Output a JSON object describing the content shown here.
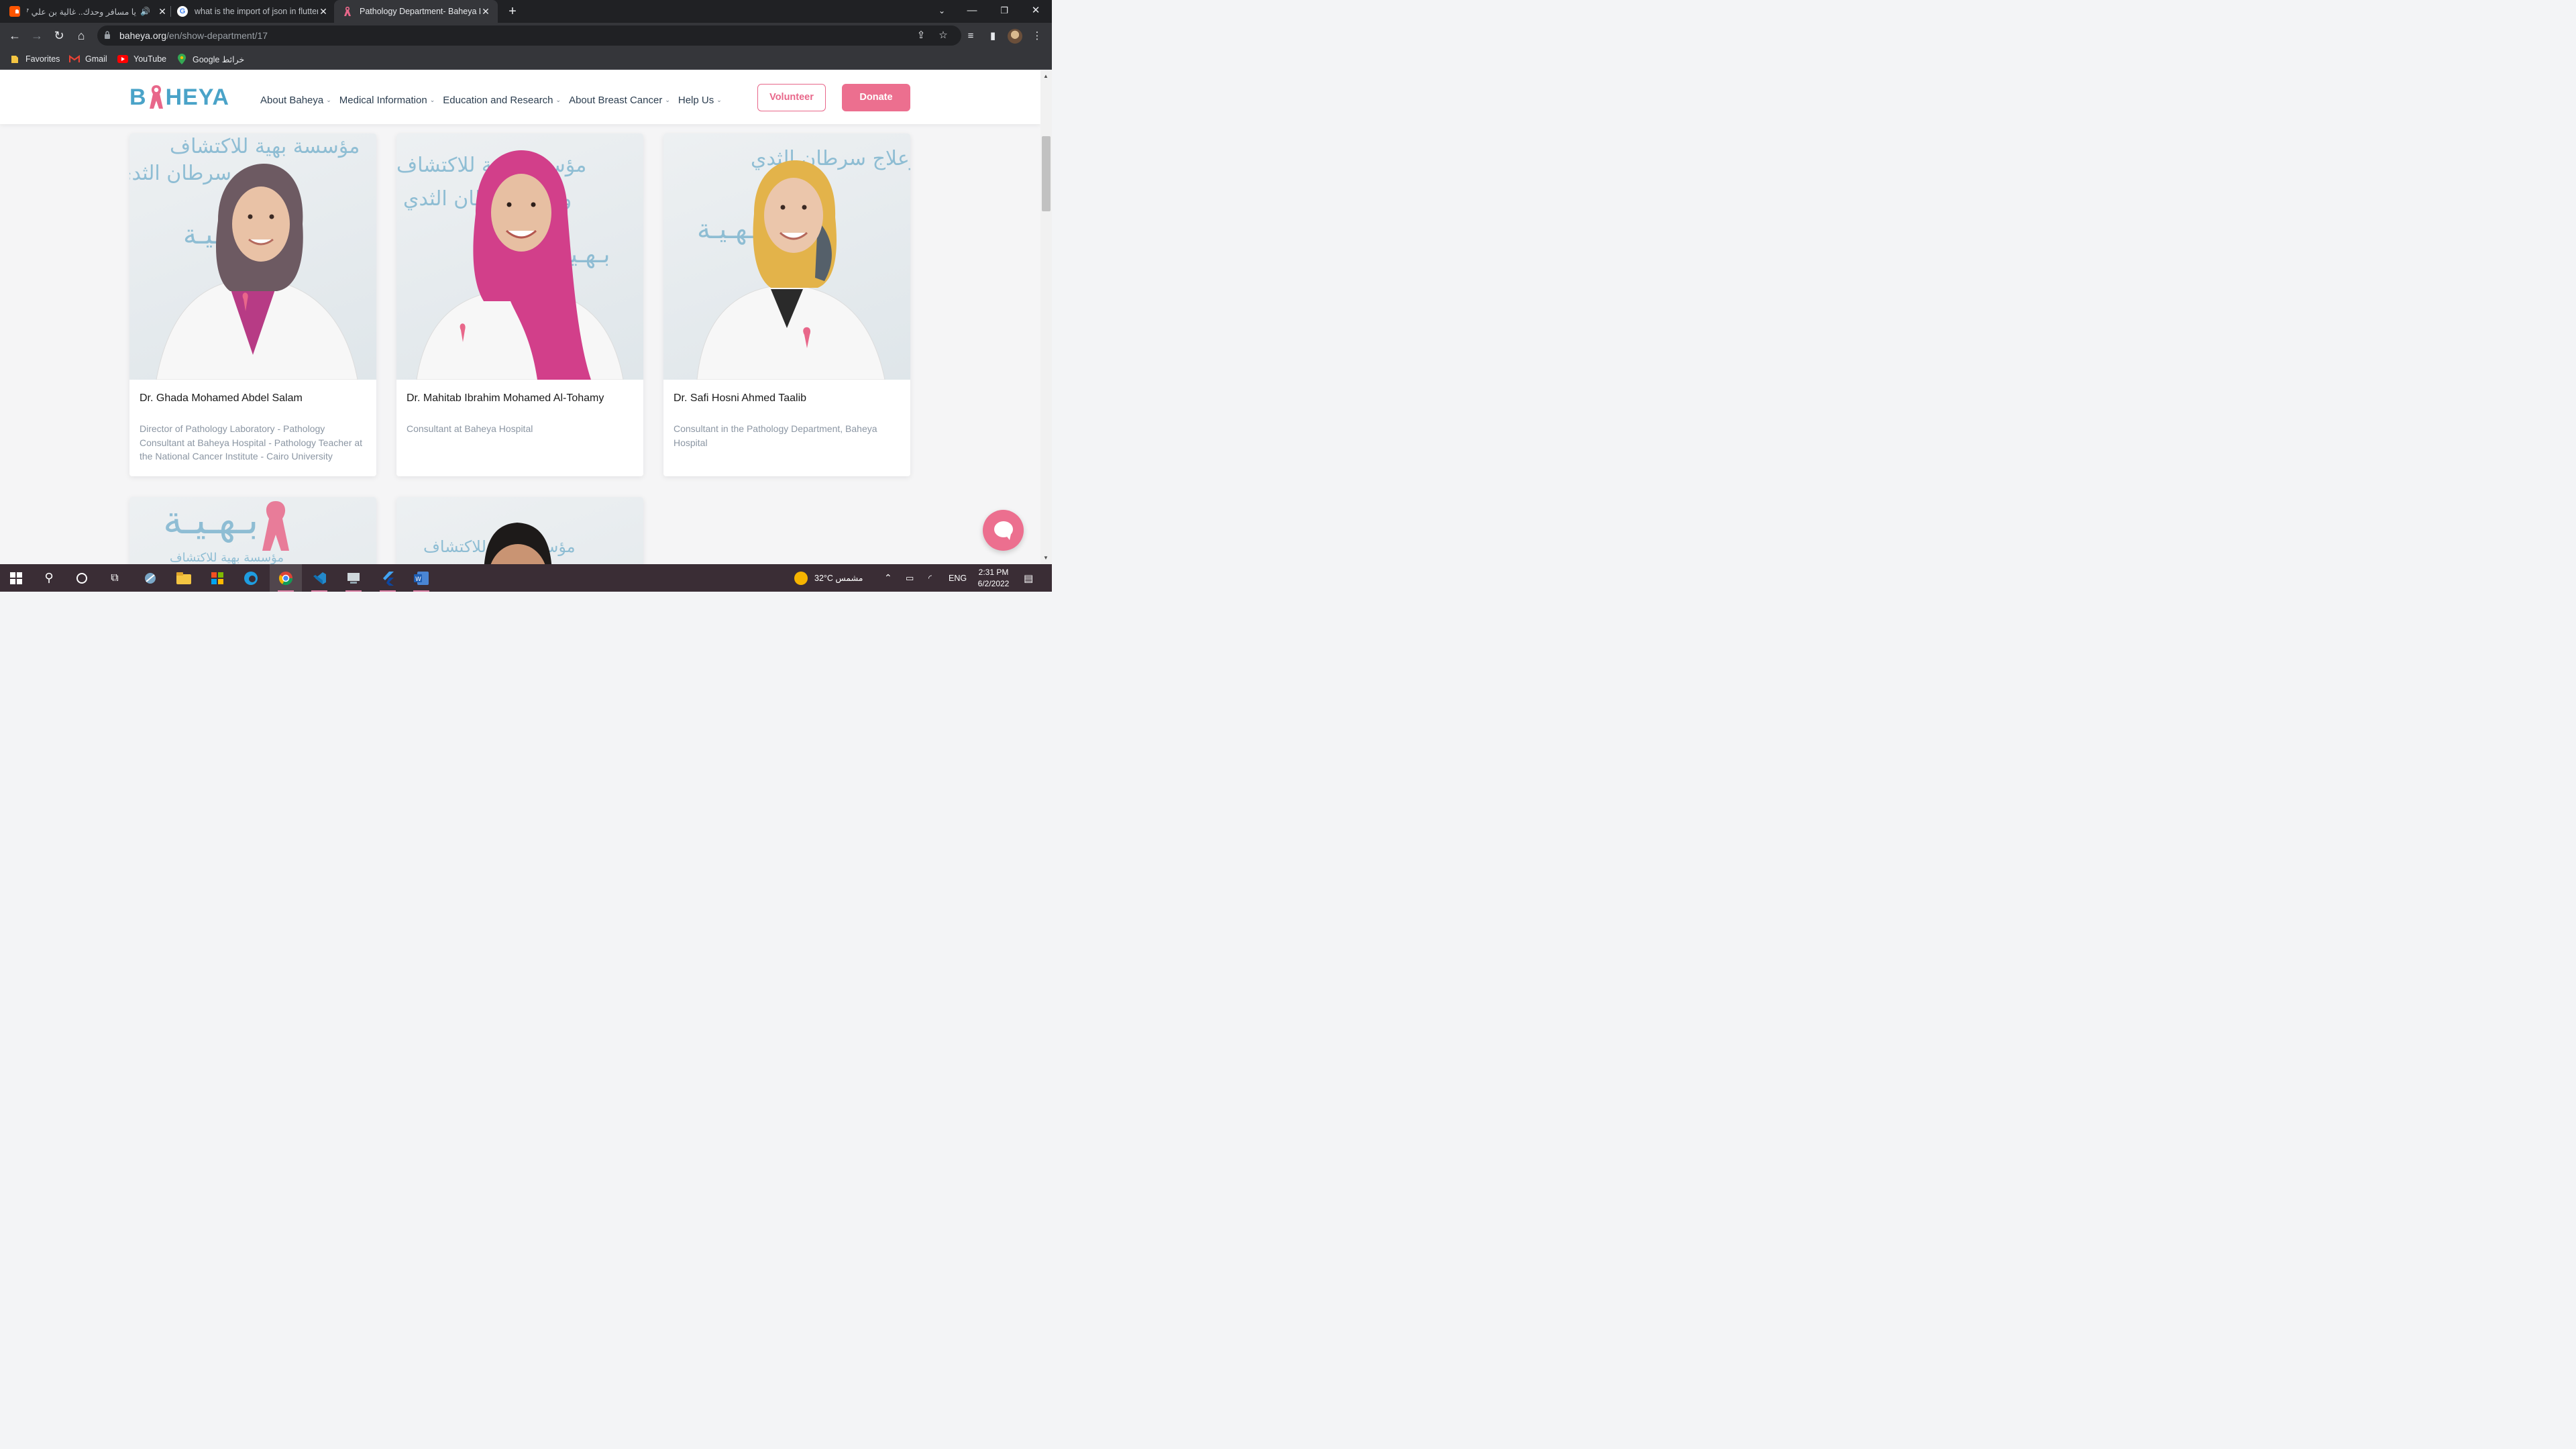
{
  "browser": {
    "tabs": [
      {
        "title": "يا مسافر وحدك.. غالية بن علي 7",
        "icon": "soundcloud-icon",
        "active": false
      },
      {
        "title": "what is the import of json in flutter",
        "icon": "google-icon",
        "active": false
      },
      {
        "title": "Pathology Department- Baheya Hospital",
        "icon": "pink-ribbon-icon",
        "active": true
      }
    ],
    "url_host": "baheya.org",
    "url_path": "/en/show-department/17",
    "bookmarks": [
      {
        "label": "Favorites",
        "icon": "folder-icon"
      },
      {
        "label": "Gmail",
        "icon": "gmail-icon"
      },
      {
        "label": "YouTube",
        "icon": "youtube-icon"
      },
      {
        "label": "Google خرائط",
        "icon": "google-maps-icon"
      }
    ]
  },
  "site": {
    "logo_text_left": "B",
    "logo_text_right": "HEYA",
    "menu": [
      {
        "label": "About Baheya"
      },
      {
        "label": "Medical Information"
      },
      {
        "label": "Education and Research"
      },
      {
        "label": "About Breast Cancer"
      },
      {
        "label": "Help Us"
      }
    ],
    "volunteer_label": "Volunteer",
    "donate_label": "Donate",
    "brand_pink": "#ec6f8f",
    "brand_blue": "#4aa3c8"
  },
  "doctors": [
    {
      "name": "Dr. Ghada Mohamed Abdel Salam",
      "role": "Director of Pathology Laboratory - Pathology Consultant at Baheya Hospital - Pathology Teacher at the National Cancer Institute - Cairo University",
      "hijab_color": "#6d5a62"
    },
    {
      "name": "Dr. Mahitab Ibrahim Mohamed Al-Tohamy",
      "role": "Consultant at Baheya Hospital",
      "hijab_color": "#d23f8a"
    },
    {
      "name": "Dr. Safi Hosni Ahmed Taalib",
      "role": "Consultant in the Pathology Department, Baheya Hospital",
      "hijab_color": "#e3b34a"
    }
  ],
  "photo_backdrop": {
    "line1": "مؤسسة بهية للاكتشاف",
    "line2": "وعلاج سرطان الثدي",
    "brand": "بـهـيـة"
  },
  "taskbar": {
    "weather": "32°C  مشمس",
    "language": "ENG",
    "time": "2:31 PM",
    "date": "6/2/2022"
  }
}
